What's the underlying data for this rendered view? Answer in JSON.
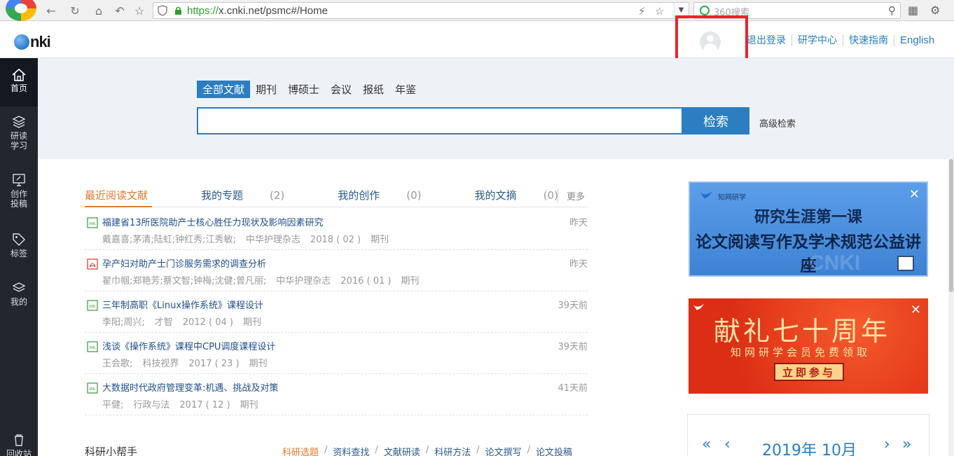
{
  "browser": {
    "url_scheme": "https://",
    "url_rest": "x.cnki.net/psmc#/Home",
    "search_placeholder": "360搜索"
  },
  "header": {
    "logo_text": "nki",
    "links": [
      "退出登录",
      "研学中心",
      "快速指南",
      "English"
    ]
  },
  "sidebar": {
    "items": [
      {
        "label": "首页",
        "icon": "home-icon"
      },
      {
        "label": "研读\n学习",
        "icon": "layers-icon"
      },
      {
        "label": "创作\n投稿",
        "icon": "edit-monitor-icon"
      },
      {
        "label": "标签",
        "icon": "tag-icon"
      },
      {
        "label": "我的",
        "icon": "stack-icon"
      },
      {
        "label": "回收站",
        "icon": "trash-icon"
      }
    ]
  },
  "search": {
    "tabs": [
      "全部文献",
      "期刊",
      "博硕士",
      "会议",
      "报纸",
      "年鉴"
    ],
    "button": "检索",
    "advanced": "高级检索",
    "value": ""
  },
  "recent": {
    "tabs": [
      {
        "label": "最近阅读文献",
        "count": ""
      },
      {
        "label": "我的专题",
        "count": "(2)"
      },
      {
        "label": "我的创作",
        "count": "(0)"
      },
      {
        "label": "我的文摘",
        "count": "(0)"
      }
    ],
    "more": "更多",
    "docs": [
      {
        "type": "xml",
        "title": "福建省13所医院助产士核心胜任力现状及影响因素研究",
        "time": "昨天",
        "authors": "戴嘉喜;茅清;陆虹;钟红秀;江秀敏;",
        "source": "中华护理杂志",
        "issue": "2018 ( 02 )",
        "kind": "期刊"
      },
      {
        "type": "pdf",
        "title": "孕产妇对助产士门诊服务需求的调查分析",
        "time": "昨天",
        "authors": "翟巾帼;郑艳芳;蔡文智;钟梅;沈健;曾凡丽;",
        "source": "中华护理杂志",
        "issue": "2016 ( 01 )",
        "kind": "期刊"
      },
      {
        "type": "xml",
        "title": "三年制高职《Linux操作系统》课程设计",
        "time": "39天前",
        "authors": "李阳;周兴;",
        "source": "才智",
        "issue": "2012 ( 04 )",
        "kind": "期刊"
      },
      {
        "type": "xml",
        "title": "浅谈《操作系统》课程中CPU调度课程设计",
        "time": "39天前",
        "authors": "王会歌;",
        "source": "科技视界",
        "issue": "2017 ( 23 )",
        "kind": "期刊"
      },
      {
        "type": "xml",
        "title": "大数据时代政府管理变革:机遇、挑战及对策",
        "time": "41天前",
        "authors": "平健;",
        "source": "行政与法",
        "issue": "2017 ( 12 )",
        "kind": "期刊"
      }
    ]
  },
  "helper": {
    "title": "科研小帮手",
    "links": [
      "科研选题",
      "资料查找",
      "文献研读",
      "科研方法",
      "论文撰写",
      "论文投稿"
    ]
  },
  "banner1": {
    "brand": "知网研学",
    "line1": "研究生涯第一课",
    "line2": "论文阅读写作及学术规范公益讲座",
    "watermark": "CNKI"
  },
  "banner2": {
    "brand": "知网研学",
    "line1": "献礼七十周年",
    "line2": "知网研学会员免费领取",
    "button": "立即参与"
  },
  "calendar": {
    "title": "2019年 10月"
  }
}
